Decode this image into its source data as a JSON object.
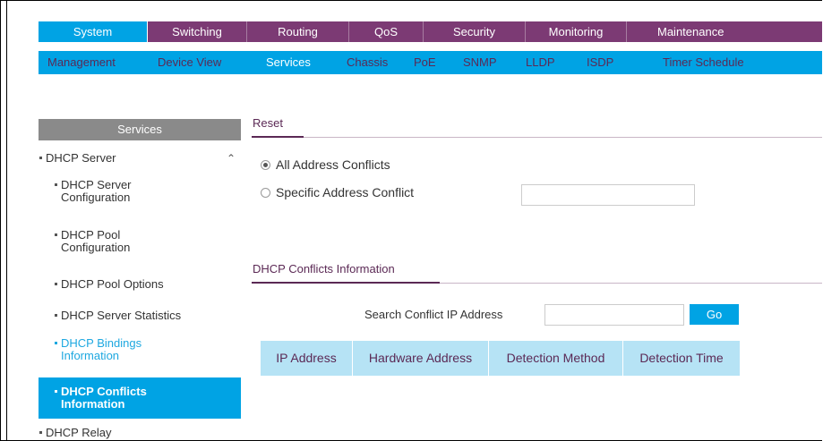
{
  "top_nav": [
    {
      "label": "System",
      "active": true
    },
    {
      "label": "Switching",
      "active": false
    },
    {
      "label": "Routing",
      "active": false
    },
    {
      "label": "QoS",
      "active": false
    },
    {
      "label": "Security",
      "active": false
    },
    {
      "label": "Monitoring",
      "active": false
    },
    {
      "label": "Maintenance",
      "active": false
    }
  ],
  "sub_nav": [
    {
      "label": "Management",
      "active": false
    },
    {
      "label": "Device View",
      "active": false
    },
    {
      "label": "Services",
      "active": true
    },
    {
      "label": "Chassis",
      "active": false
    },
    {
      "label": "PoE",
      "active": false
    },
    {
      "label": "SNMP",
      "active": false
    },
    {
      "label": "LLDP",
      "active": false
    },
    {
      "label": "ISDP",
      "active": false
    },
    {
      "label": "Timer Schedule",
      "active": false
    }
  ],
  "sidebar": {
    "title": "Services",
    "items": [
      {
        "label": "DHCP Server",
        "level": 0,
        "expanded": true
      },
      {
        "label": "DHCP Server Configuration",
        "level": 1
      },
      {
        "label": "DHCP Pool Configuration",
        "level": 1
      },
      {
        "label": "DHCP Pool Options",
        "level": 1
      },
      {
        "label": "DHCP Server Statistics",
        "level": 1
      },
      {
        "label": "DHCP Bindings Information",
        "level": 1,
        "link": true
      },
      {
        "label": "DHCP Conflicts Information",
        "level": 1,
        "active": true
      },
      {
        "label": "DHCP Relay",
        "level": 0
      }
    ]
  },
  "reset": {
    "title": "Reset",
    "option_all": "All Address Conflicts",
    "option_specific": "Specific Address Conflict",
    "selected": "all",
    "specific_value": ""
  },
  "conflicts": {
    "title": "DHCP Conflicts Information",
    "search_label": "Search Conflict IP Address",
    "search_value": "",
    "go_label": "Go",
    "columns": [
      "IP Address",
      "Hardware Address",
      "Detection Method",
      "Detection Time"
    ],
    "rows": []
  },
  "colors": {
    "brand_purple": "#7c3a74",
    "accent_blue": "#00a3e4",
    "sidebar_header": "#8a8a8a",
    "table_header": "#b6e3f5"
  }
}
